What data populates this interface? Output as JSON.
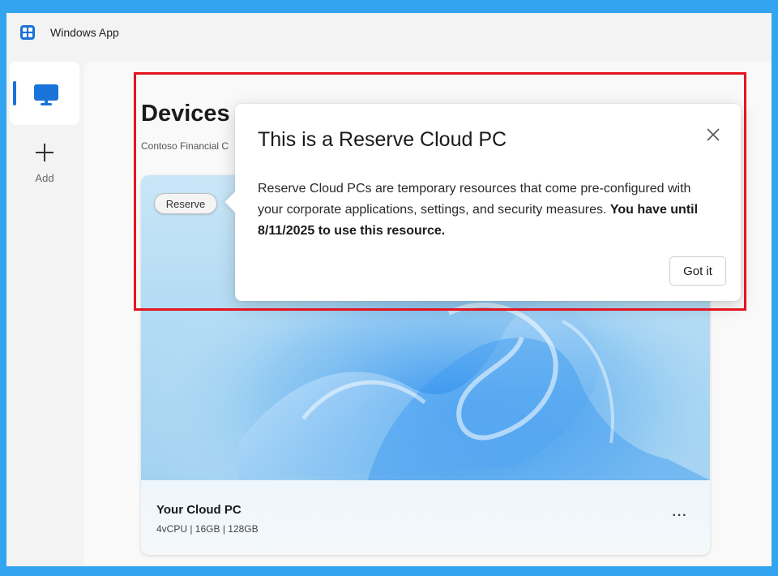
{
  "window": {
    "app_title": "Windows App"
  },
  "nav": {
    "items": [
      {
        "label": "",
        "icon": "monitor-icon"
      },
      {
        "label": "Add",
        "icon": "plus-icon"
      }
    ]
  },
  "main": {
    "page_title": "Devices",
    "org_label": "Contoso Financial C",
    "card": {
      "badge": "Reserve",
      "name": "Your Cloud PC",
      "specs": "4vCPU | 16GB | 128GB",
      "more_label": "···"
    }
  },
  "teaching_tip": {
    "title": "This is a Reserve Cloud PC",
    "body": "Reserve Cloud PCs are temporary resources that come pre-configured with your corporate applications, settings, and security measures. ",
    "body_bold": "You have until 8/11/2025 to use this resource.",
    "button_label": "Got it",
    "close_icon": "close-icon"
  },
  "colors": {
    "accent": "#1a73d9",
    "highlight": "#e3141f",
    "frame": "#33a4f0"
  }
}
